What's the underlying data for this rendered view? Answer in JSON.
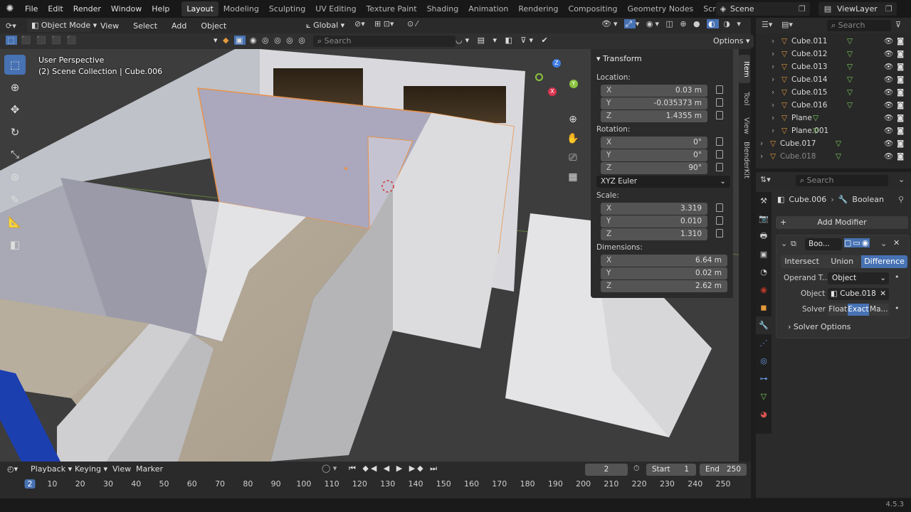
{
  "app": {
    "menu": [
      "File",
      "Edit",
      "Render",
      "Window",
      "Help"
    ],
    "workspaces": [
      "Layout",
      "Modeling",
      "Sculpting",
      "UV Editing",
      "Texture Paint",
      "Shading",
      "Animation",
      "Rendering",
      "Compositing",
      "Geometry Nodes",
      "Scripting"
    ],
    "active_workspace": "Layout",
    "add_workspace": "+",
    "scene": "Scene",
    "view_layer": "ViewLayer",
    "version": "4.5.3"
  },
  "viewport_header": {
    "mode": "Object Mode",
    "menu": [
      "View",
      "Select",
      "Add",
      "Object"
    ],
    "orientation": "Global",
    "search_placeholder": "Search",
    "options": "Options"
  },
  "viewport": {
    "perspective": "User Perspective",
    "collection": "(2) Scene Collection | Cube.006"
  },
  "transform": {
    "title": "Transform",
    "location_label": "Location:",
    "location": [
      {
        "ax": "X",
        "v": "0.03 m"
      },
      {
        "ax": "Y",
        "v": "-0.035373 m"
      },
      {
        "ax": "Z",
        "v": "1.4355 m"
      }
    ],
    "rotation_label": "Rotation:",
    "rotation": [
      {
        "ax": "X",
        "v": "0°"
      },
      {
        "ax": "Y",
        "v": "0°"
      },
      {
        "ax": "Z",
        "v": "90°"
      }
    ],
    "rotation_mode": "XYZ Euler",
    "scale_label": "Scale:",
    "scale": [
      {
        "ax": "X",
        "v": "3.319"
      },
      {
        "ax": "Y",
        "v": "0.010"
      },
      {
        "ax": "Z",
        "v": "1.310"
      }
    ],
    "dimensions_label": "Dimensions:",
    "dimensions": [
      {
        "ax": "X",
        "v": "6.64 m"
      },
      {
        "ax": "Y",
        "v": "0.02 m"
      },
      {
        "ax": "Z",
        "v": "2.62 m"
      }
    ]
  },
  "sidebar_tabs": [
    "Item",
    "Tool",
    "View",
    "BlenderKit"
  ],
  "outliner": {
    "search_placeholder": "Search",
    "items": [
      {
        "name": "Cube.011"
      },
      {
        "name": "Cube.012"
      },
      {
        "name": "Cube.013"
      },
      {
        "name": "Cube.014"
      },
      {
        "name": "Cube.015"
      },
      {
        "name": "Cube.016"
      },
      {
        "name": "Plane"
      },
      {
        "name": "Plane.001"
      },
      {
        "name": "Cube.017"
      },
      {
        "name": "Cube.018"
      }
    ]
  },
  "properties": {
    "search_placeholder": "Search",
    "object": "Cube.006",
    "modifier_context": "Boolean",
    "add_modifier": "Add Modifier",
    "modifier_name": "Boo...",
    "ops": [
      "Intersect",
      "Union",
      "Difference"
    ],
    "active_op": "Difference",
    "operand_label": "Operand T...",
    "operand_value": "Object",
    "object_label": "Object",
    "object_value": "Cube.018",
    "solver_label": "Solver",
    "solvers": [
      "Float",
      "Exact",
      "Ma..."
    ],
    "active_solver": "Exact",
    "solver_options": "Solver Options"
  },
  "timeline": {
    "menu": [
      "Playback",
      "Keying",
      "View",
      "Marker"
    ],
    "current_frame": "2",
    "start_label": "Start",
    "start": "1",
    "end_label": "End",
    "end": "250",
    "frames": [
      "2",
      "10",
      "20",
      "30",
      "40",
      "50",
      "60",
      "70",
      "80",
      "90",
      "100",
      "110",
      "120",
      "130",
      "140",
      "150",
      "160",
      "170",
      "180",
      "190",
      "200",
      "210",
      "220",
      "230",
      "240",
      "250"
    ]
  }
}
